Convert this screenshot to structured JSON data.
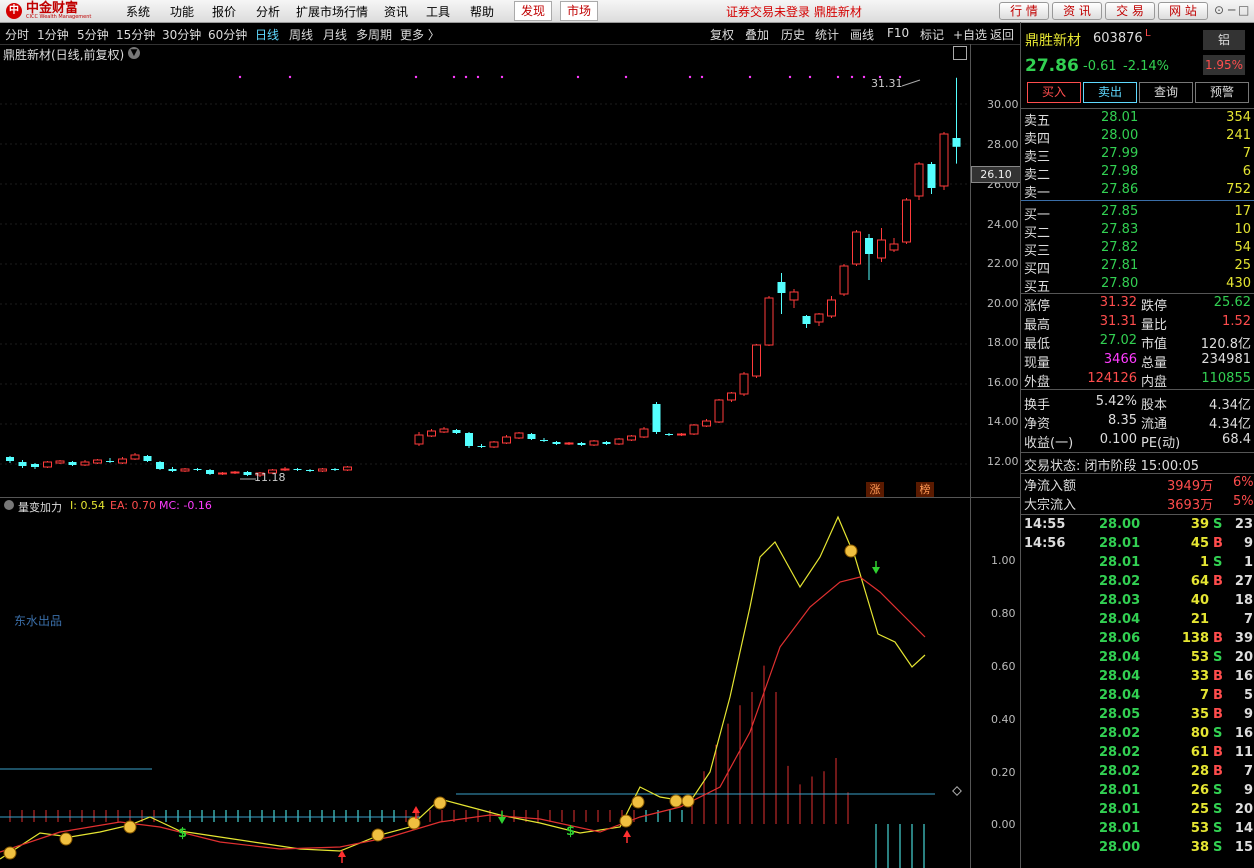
{
  "menubar": {
    "logo_mark": "中",
    "logo_name": "中金财富",
    "logo_sub": "CICC Wealth Management",
    "items": [
      "系统",
      "功能",
      "报价",
      "分析",
      "扩展市场行情",
      "资讯",
      "工具",
      "帮助"
    ],
    "highlight_1": "发现",
    "highlight_2": "市场",
    "status": "证券交易未登录  鼎胜新材",
    "buttons": [
      "行 情",
      "资 讯",
      "交 易",
      "网 站"
    ],
    "window_controls": [
      "⊙",
      "─",
      "□",
      "✕"
    ]
  },
  "toolbar": {
    "periods": [
      "分时",
      "1分钟",
      "5分钟",
      "15分钟",
      "30分钟",
      "60分钟",
      "日线",
      "周线",
      "月线",
      "多周期",
      "更多 〉"
    ],
    "active_period": "日线",
    "tools": [
      "复权",
      "叠加",
      "历史",
      "统计",
      "画线",
      "F10",
      "标记",
      "+自选",
      "返回"
    ]
  },
  "chart": {
    "title": "鼎胜新材(日线,前复权)",
    "high_label": "31.31",
    "low_label": "11.18",
    "price_tag": "26.10",
    "y_ticks": [
      "30.00",
      "28.00",
      "26.00",
      "24.00",
      "22.00",
      "20.00",
      "18.00",
      "16.00",
      "14.00",
      "12.00"
    ],
    "marker_1": "涨",
    "marker_2": "榜"
  },
  "indicator": {
    "name": "量变加力",
    "i_label": "I: 0.54",
    "ea_label": "EA: 0.70",
    "mc_label": "MC: -0.16",
    "watermark": "东水出品",
    "y_ticks": [
      "1.00",
      "0.80",
      "0.60",
      "0.40",
      "0.20",
      "0.00"
    ]
  },
  "quote": {
    "name": "鼎胜新材",
    "code": "603876",
    "flag": "L",
    "tag": "铝",
    "price": "27.86",
    "change": "-0.61",
    "change_pct": "-2.14%",
    "amplitude_pct": "1.95%",
    "buttons": [
      "买入",
      "卖出",
      "查询",
      "预警"
    ],
    "asks": [
      {
        "label": "卖五",
        "price": "28.01",
        "vol": "354"
      },
      {
        "label": "卖四",
        "price": "28.00",
        "vol": "241"
      },
      {
        "label": "卖三",
        "price": "27.99",
        "vol": "7"
      },
      {
        "label": "卖二",
        "price": "27.98",
        "vol": "6"
      },
      {
        "label": "卖一",
        "price": "27.86",
        "vol": "752"
      }
    ],
    "bids": [
      {
        "label": "买一",
        "price": "27.85",
        "vol": "17"
      },
      {
        "label": "买二",
        "price": "27.83",
        "vol": "10"
      },
      {
        "label": "买三",
        "price": "27.82",
        "vol": "54"
      },
      {
        "label": "买四",
        "price": "27.81",
        "vol": "25"
      },
      {
        "label": "买五",
        "price": "27.80",
        "vol": "430"
      }
    ],
    "stats": [
      {
        "l1": "涨停",
        "v1": "31.32",
        "c1": "red",
        "l2": "跌停",
        "v2": "25.62",
        "c2": "grn"
      },
      {
        "l1": "最高",
        "v1": "31.31",
        "c1": "red",
        "l2": "量比",
        "v2": "1.52",
        "c2": "red"
      },
      {
        "l1": "最低",
        "v1": "27.02",
        "c1": "grn",
        "l2": "市值",
        "v2": "120.8亿",
        "c2": "wht"
      },
      {
        "l1": "现量",
        "v1": "3466",
        "c1": "mag",
        "l2": "总量",
        "v2": "234981",
        "c2": "wht"
      },
      {
        "l1": "外盘",
        "v1": "124126",
        "c1": "red",
        "l2": "内盘",
        "v2": "110855",
        "c2": "grn"
      },
      {
        "l1": "换手",
        "v1": "5.42%",
        "c1": "wht",
        "l2": "股本",
        "v2": "4.34亿",
        "c2": "wht"
      },
      {
        "l1": "净资",
        "v1": "8.35",
        "c1": "wht",
        "l2": "流通",
        "v2": "4.34亿",
        "c2": "wht"
      },
      {
        "l1": "收益(一)",
        "v1": "0.100",
        "c1": "wht",
        "l2": "PE(动)",
        "v2": "68.4",
        "c2": "wht"
      }
    ],
    "trade_status": "交易状态: 闭市阶段 15:00:05",
    "net_inflow": {
      "label": "净流入额",
      "value": "3949万",
      "pct": "6%"
    },
    "block_inflow": {
      "label": "大宗流入",
      "value": "3693万",
      "pct": "5%"
    },
    "ticks": [
      {
        "t": "14:55",
        "p": "28.00",
        "v": "39",
        "s": "S",
        "n": "23"
      },
      {
        "t": "14:56",
        "p": "28.01",
        "v": "45",
        "s": "B",
        "n": "9"
      },
      {
        "t": "",
        "p": "28.01",
        "v": "1",
        "s": "S",
        "n": "1"
      },
      {
        "t": "",
        "p": "28.02",
        "v": "64",
        "s": "B",
        "n": "27"
      },
      {
        "t": "",
        "p": "28.03",
        "v": "40",
        "s": "",
        "n": "18"
      },
      {
        "t": "",
        "p": "28.04",
        "v": "21",
        "s": "",
        "n": "7"
      },
      {
        "t": "",
        "p": "28.06",
        "v": "138",
        "s": "B",
        "n": "39"
      },
      {
        "t": "",
        "p": "28.04",
        "v": "53",
        "s": "S",
        "n": "20"
      },
      {
        "t": "",
        "p": "28.04",
        "v": "33",
        "s": "B",
        "n": "16"
      },
      {
        "t": "",
        "p": "28.04",
        "v": "7",
        "s": "B",
        "n": "5"
      },
      {
        "t": "",
        "p": "28.05",
        "v": "35",
        "s": "B",
        "n": "9"
      },
      {
        "t": "",
        "p": "28.02",
        "v": "80",
        "s": "S",
        "n": "16"
      },
      {
        "t": "",
        "p": "28.02",
        "v": "61",
        "s": "B",
        "n": "11"
      },
      {
        "t": "",
        "p": "28.02",
        "v": "28",
        "s": "B",
        "n": "7"
      },
      {
        "t": "",
        "p": "28.01",
        "v": "26",
        "s": "S",
        "n": "9"
      },
      {
        "t": "",
        "p": "28.01",
        "v": "25",
        "s": "S",
        "n": "20"
      },
      {
        "t": "",
        "p": "28.01",
        "v": "53",
        "s": "S",
        "n": "14"
      },
      {
        "t": "",
        "p": "28.00",
        "v": "38",
        "s": "S",
        "n": "15"
      }
    ]
  },
  "chart_data": {
    "type": "candlestick",
    "title": "鼎胜新材(日线,前复权)",
    "ylim": [
      11,
      31.5
    ],
    "candles": [
      [
        12.35,
        12.15,
        12.4,
        12.05
      ],
      [
        12.1,
        11.9,
        12.2,
        11.8
      ],
      [
        12.0,
        11.85,
        12.05,
        11.75
      ],
      [
        11.85,
        12.1,
        12.15,
        11.8
      ],
      [
        12.05,
        12.15,
        12.2,
        12.0
      ],
      [
        12.1,
        11.95,
        12.15,
        11.9
      ],
      [
        11.95,
        12.1,
        12.2,
        11.9
      ],
      [
        12.05,
        12.2,
        12.25,
        12.0
      ],
      [
        12.15,
        12.1,
        12.3,
        12.05
      ],
      [
        12.05,
        12.25,
        12.35,
        12.0
      ],
      [
        12.25,
        12.45,
        12.55,
        12.2
      ],
      [
        12.4,
        12.15,
        12.45,
        12.1
      ],
      [
        12.1,
        11.75,
        12.15,
        11.7
      ],
      [
        11.75,
        11.65,
        11.85,
        11.6
      ],
      [
        11.65,
        11.75,
        11.8,
        11.6
      ],
      [
        11.75,
        11.7,
        11.8,
        11.65
      ],
      [
        11.7,
        11.5,
        11.75,
        11.45
      ],
      [
        11.5,
        11.55,
        11.6,
        11.45
      ],
      [
        11.55,
        11.6,
        11.65,
        11.5
      ],
      [
        11.6,
        11.45,
        11.65,
        11.4
      ],
      [
        11.45,
        11.55,
        11.6,
        11.35
      ],
      [
        11.55,
        11.7,
        11.75,
        11.5
      ],
      [
        11.7,
        11.75,
        11.85,
        11.65
      ],
      [
        11.75,
        11.7,
        11.8,
        11.65
      ],
      [
        11.7,
        11.65,
        11.75,
        11.6
      ],
      [
        11.65,
        11.75,
        11.8,
        11.6
      ],
      [
        11.75,
        11.7,
        11.8,
        11.65
      ],
      [
        11.7,
        11.85,
        11.9,
        11.65
      ],
      [
        13.0,
        13.45,
        13.6,
        12.9
      ],
      [
        13.4,
        13.65,
        13.75,
        13.35
      ],
      [
        13.6,
        13.75,
        13.85,
        13.55
      ],
      [
        13.7,
        13.55,
        13.75,
        13.5
      ],
      [
        13.55,
        12.9,
        13.6,
        12.8
      ],
      [
        12.9,
        12.85,
        13.0,
        12.8
      ],
      [
        12.85,
        13.1,
        13.15,
        12.8
      ],
      [
        13.05,
        13.35,
        13.45,
        13.0
      ],
      [
        13.3,
        13.55,
        13.6,
        13.25
      ],
      [
        13.5,
        13.25,
        13.55,
        13.2
      ],
      [
        13.2,
        13.15,
        13.3,
        13.1
      ],
      [
        13.1,
        13.0,
        13.15,
        12.95
      ],
      [
        13.0,
        13.05,
        13.1,
        12.95
      ],
      [
        13.05,
        12.95,
        13.1,
        12.9
      ],
      [
        12.95,
        13.15,
        13.2,
        12.9
      ],
      [
        13.1,
        13.0,
        13.15,
        12.95
      ],
      [
        13.0,
        13.25,
        13.3,
        12.95
      ],
      [
        13.2,
        13.4,
        13.45,
        13.15
      ],
      [
        13.35,
        13.75,
        13.85,
        13.3
      ],
      [
        15.0,
        13.6,
        15.1,
        13.5
      ],
      [
        13.5,
        13.45,
        13.55,
        13.4
      ],
      [
        13.45,
        13.5,
        13.55,
        13.4
      ],
      [
        13.5,
        13.95,
        14.0,
        13.45
      ],
      [
        13.9,
        14.15,
        14.25,
        13.85
      ],
      [
        14.1,
        15.2,
        15.25,
        14.05
      ],
      [
        15.2,
        15.55,
        15.6,
        15.1
      ],
      [
        15.5,
        16.5,
        16.6,
        15.4
      ],
      [
        16.4,
        17.95,
        18.0,
        16.3
      ],
      [
        17.95,
        20.3,
        20.4,
        17.9
      ],
      [
        21.1,
        20.55,
        21.55,
        19.5
      ],
      [
        20.2,
        20.6,
        20.75,
        19.8
      ],
      [
        19.4,
        19.0,
        19.45,
        18.8
      ],
      [
        19.1,
        19.5,
        19.55,
        18.9
      ],
      [
        19.4,
        20.2,
        20.4,
        19.3
      ],
      [
        20.5,
        21.9,
        22.0,
        20.4
      ],
      [
        22.0,
        23.6,
        23.7,
        21.9
      ],
      [
        23.3,
        22.5,
        23.5,
        21.2
      ],
      [
        22.3,
        23.2,
        23.8,
        22.1
      ],
      [
        22.7,
        23.0,
        23.3,
        22.6
      ],
      [
        23.1,
        25.2,
        25.3,
        23.0
      ],
      [
        25.4,
        27.0,
        27.1,
        25.2
      ],
      [
        27.0,
        25.8,
        27.1,
        25.5
      ],
      [
        25.9,
        28.5,
        28.6,
        25.7
      ],
      [
        28.3,
        27.86,
        31.31,
        27.02
      ]
    ]
  }
}
